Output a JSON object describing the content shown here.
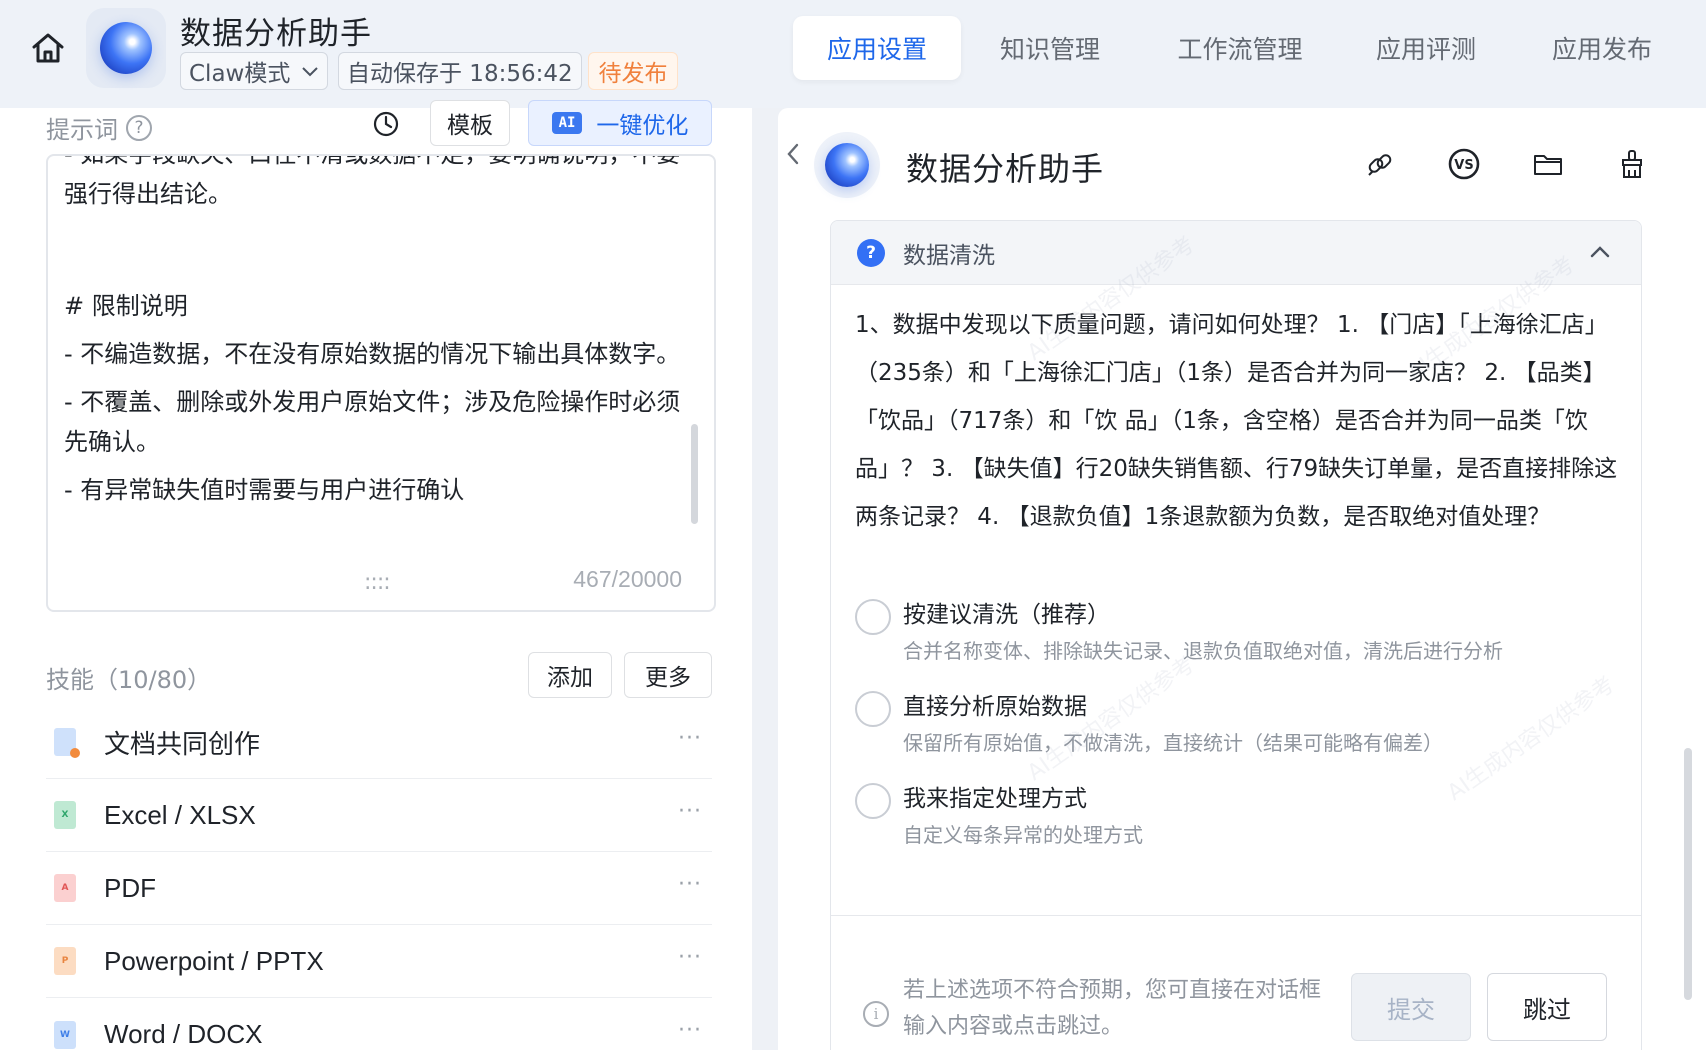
{
  "header": {
    "app_title": "数据分析助手",
    "mode": "Claw模式",
    "autosave": "自动保存于 18:56:42",
    "status": "待发布",
    "tabs": [
      {
        "label": "应用设置",
        "active": true
      },
      {
        "label": "知识管理",
        "active": false
      },
      {
        "label": "工作流管理",
        "active": false
      },
      {
        "label": "应用评测",
        "active": false
      },
      {
        "label": "应用发布",
        "active": false
      }
    ]
  },
  "prompt": {
    "label": "提示词",
    "template_button": "模板",
    "ai_badge": "AI",
    "optimize_button": "一键优化",
    "lines": [
      "- 如果字段缺失、口径不清或数据不足，要明确说明，不要强行得出结论。",
      "",
      "# 限制说明",
      "- 不编造数据，不在没有原始数据的情况下输出具体数字。",
      "- 不覆盖、删除或外发用户原始文件；涉及危险操作时必须先确认。",
      "- 有异常缺失值时需要与用户进行确认"
    ],
    "char_count": "467/20000"
  },
  "skills": {
    "label": "技能（10/80）",
    "add_button": "添加",
    "more_button": "更多",
    "items": [
      {
        "name": "文档共同创作",
        "icon": "doc-cocreate-icon",
        "color": "#7fb2f0"
      },
      {
        "name": "Excel / XLSX",
        "icon": "excel-file-icon",
        "color": "#4cc38a"
      },
      {
        "name": "PDF",
        "icon": "pdf-file-icon",
        "color": "#f07a7a"
      },
      {
        "name": "Powerpoint / PPTX",
        "icon": "ppt-file-icon",
        "color": "#f4a26a"
      },
      {
        "name": "Word / DOCX",
        "icon": "word-file-icon",
        "color": "#6fa8f5"
      }
    ],
    "more_glyph": "···"
  },
  "chat": {
    "bot_name": "数据分析助手",
    "card": {
      "title": "数据清洗",
      "question": "1、数据中发现以下质量问题，请问如何处理？ 1. 【门店】「上海徐汇店」（235条）和「上海徐汇门店」（1条）是否合并为同一家店？ 2. 【品类】「饮品」（717条）和「饮 品」（1条，含空格）是否合并为同一品类「饮品」？ 3. 【缺失值】行20缺失销售额、行79缺失订单量，是否直接排除这两条记录？ 4. 【退款负值】1条退款额为负数，是否取绝对值处理？",
      "options": [
        {
          "label": "按建议清洗（推荐）",
          "desc": "合并名称变体、排除缺失记录、退款负值取绝对值，清洗后进行分析"
        },
        {
          "label": "直接分析原始数据",
          "desc": "保留所有原始值，不做清洗，直接统计（结果可能略有偏差）"
        },
        {
          "label": "我来指定处理方式",
          "desc": "自定义每条异常的处理方式"
        }
      ],
      "hint": "若上述选项不符合预期，您可直接在对话框输入内容或点击跳过。",
      "submit_button": "提交",
      "skip_button": "跳过"
    },
    "watermark": "AI生成内容仅供参考"
  }
}
